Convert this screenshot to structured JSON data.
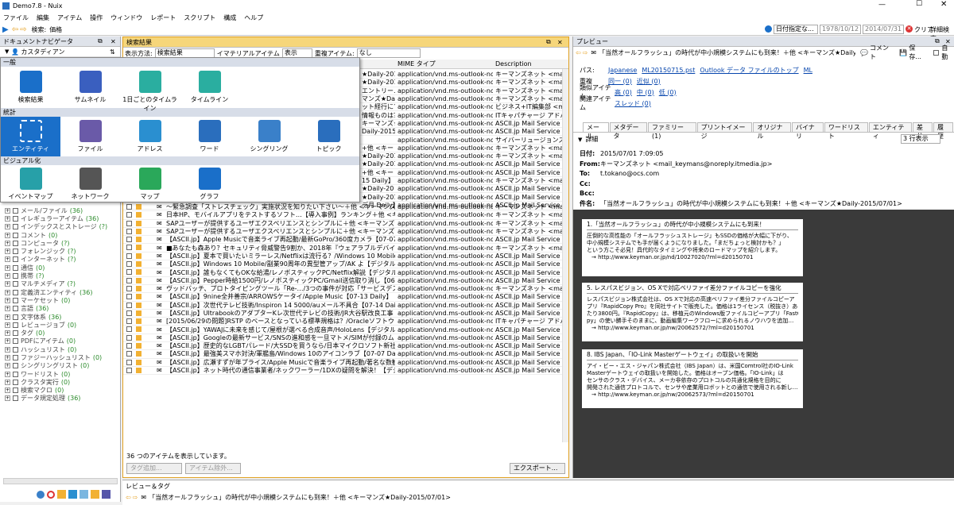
{
  "window": {
    "title": "Demo7.8 - Nuix"
  },
  "menu": [
    "ファイル",
    "編集",
    "アイテム",
    "操作",
    "ウィンドウ",
    "レポート",
    "スクリプト",
    "構成",
    "ヘルプ"
  ],
  "search": {
    "label": "検索:",
    "value": "価格",
    "date_filter": "日付指定な...",
    "date_from": "1978/10/12",
    "date_to": "2014/07/31",
    "clear": "クリア",
    "advanced": "詳細検索"
  },
  "left_panel": {
    "title": "ドキュメントナビゲータ",
    "dropdown": "カスタディアン",
    "tree": [
      {
        "label": "メール/ファイル",
        "count": "(36)"
      },
      {
        "label": "イレギュラーアイテム",
        "count": "(36)"
      },
      {
        "label": "インデックスとストレージ",
        "count": "(?)"
      },
      {
        "label": "コメント",
        "count": "(0)"
      },
      {
        "label": "コンピュータ",
        "count": "(?)"
      },
      {
        "label": "フォレンジック",
        "count": "(?)"
      },
      {
        "label": "インターネット",
        "count": "(?)"
      },
      {
        "label": "通信",
        "count": "(0)"
      },
      {
        "label": "携帯",
        "count": "(?)"
      },
      {
        "label": "マルチメディア",
        "count": "(?)"
      },
      {
        "label": "定義済エンティティ",
        "count": "(36)"
      },
      {
        "label": "マーケセット",
        "count": "(0)"
      },
      {
        "label": "言語",
        "count": "(36)"
      },
      {
        "label": "文字体系",
        "count": "(36)"
      },
      {
        "label": "レビュージョブ",
        "count": "(0)"
      },
      {
        "label": "タグ",
        "count": "(0)"
      },
      {
        "label": "PDFにアイテム",
        "count": "(0)"
      },
      {
        "label": "ハッシュリスト",
        "count": "(0)"
      },
      {
        "label": "ファジーハッシュリスト",
        "count": "(0)"
      },
      {
        "label": "シングリングリスト",
        "count": "(0)"
      },
      {
        "label": "ワードリスト",
        "count": "(0)"
      },
      {
        "label": "クラスタ実行",
        "count": "(0)"
      },
      {
        "label": "検索マクロ",
        "count": "(0)"
      },
      {
        "label": "データ規定処理",
        "count": "(36)"
      }
    ]
  },
  "results": {
    "title": "検索結果",
    "view_label": "表示方法:",
    "view_value": "検索結果",
    "immaterial": "イマテリアルアイテム",
    "immaterial_value": "表示",
    "dup_label": "重複アイテム:",
    "dup_value": "なし",
    "col_mime": "MIME タイプ",
    "col_desc": "Description",
    "mime_rows": [
      "application/vnd.ms-outlook-note",
      "application/vnd.ms-outlook-note",
      "application/vnd.ms-outlook-note",
      "application/vnd.ms-outlook-note",
      "application/vnd.ms-outlook-note",
      "application/vnd.ms-outlook-note",
      "application/vnd.ms-outlook-note",
      "application/vnd.ms-outlook-note",
      "application/vnd.ms-outlook-note",
      "application/vnd.ms-outlook-note",
      "application/vnd.ms-outlook-note",
      "application/vnd.ms-outlook-note",
      "application/vnd.ms-outlook-note",
      "application/vnd.ms-outlook-note",
      "application/vnd.ms-outlook-note",
      "application/vnd.ms-outlook-note",
      "application/vnd.ms-outlook-note"
    ],
    "desc_rows": [
      "キーマンズネット <mail_keyman",
      "キーマンズネット <mail_keyman",
      "キーマンズネット <mail_keyman",
      "キーマンズネット <mail_keyman",
      "ビジネス+IT編集部 <mail@",
      "ITキャパチャージ アドバンス",
      "ASCII.jp Mail Service <noreply",
      "ASCII.jp Mail Service <noreply",
      "サイバーリュージョンズ <mk@",
      "キーマンズネット <mail_keyman",
      "キーマンズネット <mail_keyman",
      "ASCII.jp Mail Service <noreply",
      "ASCII.jp Mail Service <noreply",
      "キーマンズネット <mail_keyman",
      "ASCII.jp Mail Service <noreply",
      "ASCII.jp Mail Service <noreply",
      "ASCII.jp Mail Service <noreply"
    ],
    "upper_partial": [
      "★Daily-201",
      "★Daily-201",
      "エントリー...",
      "マンズ★Da",
      "ット経行にて",
      "情報ものは？",
      "キーマンズ★",
      "Daily-2015/",
      "",
      "+他 <キー",
      "★Daily-201",
      "★Daily-201",
      "+他 <キー",
      "15 Daily】",
      "★Daily-20",
      "★Daily-201",
      "デ月 Daily】"
    ],
    "rows": [
      {
        "s": "～緊急調査「ストレスチェック」実施状況を知りたい下さい～＋他 <キーマンズ★Daily-2015/",
        "m": "application/vnd.ms-outlook-note",
        "d": "キーマンズネット <mail_keyman"
      },
      {
        "s": "日本HP、モバイルアプリをテストするソフト…【導入事例】ランキング＋他 <キーマンズ★Daily-20",
        "m": "application/vnd.ms-outlook-note",
        "d": "キーマンズネット <mail_keyman"
      },
      {
        "s": "SAPユーザーが提供するユーザエクスペリエンスとシンプルに＋他 <キーマンズ★Daily-2015/",
        "m": "application/vnd.ms-outlook-note",
        "d": "キーマンズネット <mail_keyman"
      },
      {
        "s": "SAPユーザーが提供するユーザエクスペリエンスとシンプルに＋他 <キーマンズ★Daily-2015/",
        "m": "application/vnd.ms-outlook-note",
        "d": "キーマンズネット <mail_keyman"
      },
      {
        "s": "【ASCII.jp】Apple Musicで音楽ライブ再起動/最新GoPro/360度カメラ【07-07 Daily】",
        "m": "application/vnd.ms-outlook-note",
        "d": "ASCII.jp Mail Service <noreply"
      },
      {
        "s": "■あなたも森あり？セキュリティ脅威警告9割か、2018年『ウェアラブルデバイス選ビ』のロードマ",
        "m": "application/vnd.ms-outlook-note",
        "d": "キーマンズネット <mail_keyman"
      },
      {
        "s": "【ASCII.jp】夏本で買いたいミラーレス/Netflixは流行る？/Windows 10 Mobile【06-24 Daily】",
        "m": "application/vnd.ms-outlook-note",
        "d": "ASCII.jp Mail Service <noreply"
      },
      {
        "s": "【ASCII.jp】Windows 10 Mobile/副業90周年の異型管アップ/AK よ【デジタル 06-22】",
        "m": "application/vnd.ms-outlook-note",
        "d": "ASCII.jp Mail Service <noreply"
      },
      {
        "s": "【ASCII.jp】誰もなくてもOKな給湯/レノボスティックPC/Netflix解説【デジタル 06-26】",
        "m": "application/vnd.ms-outlook-note",
        "d": "ASCII.jp Mail Service <noreply"
      },
      {
        "s": "【ASCII.jp】Pepper時給1500円/レノボスティックPC/Gmail送信取り消し【06-25 Daily】",
        "m": "application/vnd.ms-outlook-note",
        "d": "ASCII.jp Mail Service <noreply"
      },
      {
        "s": "ヴッドバッチ、プロトタイピングツール「Re-…/3つの事件が対応「サービスデスクツール・・＋他 <キ",
        "m": "application/vnd.ms-outlook-note",
        "d": "キーマンズネット <mail_keyman"
      },
      {
        "s": "【ASCII.jp】9nine全井善宗/ARROWSケータイ/Apple Music【07-13 Daily】",
        "m": "application/vnd.ms-outlook-note",
        "d": "ASCII.jp Mail Service <noreply"
      },
      {
        "s": "【ASCII.jp】次世代テレビ技術/Inspiron 14 5000/auメール不具合【07-14 Daily】",
        "m": "application/vnd.ms-outlook-note",
        "d": "ASCII.jp Mail Service <noreply"
      },
      {
        "s": "【ASCII.jp】UltrabookのアダプターKレ次世代テレビの技術/JR大谷駅改良工事【デジタル 07-15】",
        "m": "application/vnd.ms-outlook-note",
        "d": "ASCII.jp Mail Service <noreply"
      },
      {
        "s": "[2015/06/29の問題]RSTP のベースとなっている標準規格は？/OracleソフトウェアのExadata配置先名",
        "m": "application/vnd.ms-outlook-note",
        "d": "ITキャパチャージ アドバンス"
      },
      {
        "s": "【ASCII.jp】YAWAJに未来を感じて/屋根が選べる合成音声/HoloLens【デジタル 06-30】",
        "m": "application/vnd.ms-outlook-note",
        "d": "ASCII.jp Mail Service <noreply"
      },
      {
        "s": "【ASCII.jp】Googleの最新サービス/SNSの進和感を一旦マトメ/SIMが付録のムック【07-01 Daily】",
        "m": "application/vnd.ms-outlook-note",
        "d": "ASCII.jp Mail Service <noreply"
      },
      {
        "s": "【ASCII.jp】歴史的なLGBTパレード/大SSDを買うなら/日本マイクロソフト新社長【07-03 Daily】",
        "m": "application/vnd.ms-outlook-note",
        "d": "ASCII.jp Mail Service <noreply"
      },
      {
        "s": "【ASCII.jp】最強美スマホ対決/軍艦島/Windows 10のアイコンラブ【07-07 Daily】",
        "m": "application/vnd.ms-outlook-note",
        "d": "ASCII.jp Mail Service <noreply"
      },
      {
        "s": "【ASCII.jp】広瀬すずが年プライス/Apple Musicで音楽ライブ再起動/著名な数観【デジタル 07-09】",
        "m": "application/vnd.ms-outlook-note",
        "d": "ASCII.jp Mail Service <noreply"
      },
      {
        "s": "【ASCII.jp】ネット時代の通信事業者/ネックワーラー/1DXの疑問を解決！【デジタル 07-08】",
        "m": "application/vnd.ms-outlook-note",
        "d": "ASCII.jp Mail Service <noreply"
      }
    ],
    "status": "36 つのアイテムを表示しています。",
    "tag_btn": "タグ追加...",
    "remove_btn": "アイテム除外...",
    "export_btn": "エクスポート..."
  },
  "dropdown_menu": {
    "sec1": "一般",
    "sec1_items": [
      "検索結果",
      "サムネイル",
      "1日ごとのタイムライン",
      "タイムライン"
    ],
    "sec2": "統計",
    "sec2_items": [
      "エンティティ",
      "ファイル",
      "アドレス",
      "ワード",
      "シングリング",
      "トピック"
    ],
    "sec3": "ビジュアル化",
    "sec3_items": [
      "イベントマップ",
      "ネットワーク",
      "マップ",
      "グラフ"
    ]
  },
  "preview": {
    "title": "プレビュー",
    "subject": "「当然オールフラッシュ」の時代が中小規模システムにも到来！＋他 <キーマンズ★Daily-2015/07/01>",
    "comment": "コメント",
    "save": "保存...",
    "auto": "自動",
    "path_label": "パス:",
    "path": [
      "Japanese",
      "ML20150715.pst",
      "Outlook データ ファイルのトップ",
      "ML"
    ],
    "dup_label": "重複",
    "dup_vals": [
      "同一 (0)",
      "近似 (0)"
    ],
    "similar_label": "類似アイテム",
    "similar_vals": [
      "高 (0)",
      "中 (0)",
      "低 (0)"
    ],
    "related_label": "関連アイテム",
    "related_val": "スレッド (0)",
    "tabs": [
      "メール",
      "メタデータ",
      "ファミリー (1)",
      "プリントイメージ",
      "オリジナル",
      "バイナリ",
      "ワードリスト",
      "エンティティ",
      "差分",
      "履歴"
    ],
    "detail": "詳細",
    "lines_sel": "3 行表示",
    "date_label": "日付:",
    "date": "2015/07/01 7:09:05",
    "from_label": "From:",
    "from": "キーマンズネット <mail_keymans@noreply.itmedia.jp>",
    "to_label": "To:",
    "to": "t.tokano@ocs.com",
    "cc_label": "Cc:",
    "bcc_label": "Bcc:",
    "subj_label": "件名:",
    "subj": "「当然オールフラッシュ」の時代が中小規模システムにも到来！＋他 <キーマンズ★Daily-2015/07/01>",
    "cards": [
      {
        "head": "1.「当然オールフラッシュ」の時代が中小規模システムにも到来！",
        "lines": [
          "圧倒的な高性能の「オールフラッシュストレージ」もSSDの価格が大幅に下がり、",
          "中小規模システムでも手が届くようになりました。「まだちょっと検討かも？」",
          "という方こそ必見！具代的なタイミングや将来のロードマップを紹介します。"
        ],
        "url": "→ http://www.keyman.or.jp/nd/10027020/?ml=d20150701"
      },
      {
        "head": "5. レスパスビジョン、OS Xで対応ベリファイ差分ファイルコピーを強化",
        "lines": [
          "レスパスビジョン株式会社は、OS Xで対応の高速ベリファイ差分ファイルコピーア",
          "プリ『RapidCopy Pro』を同社サイトで販売した。価格は1ライセンス（税抜き）あ",
          "たり3800円。『RapidCopy』は、移植元のWindows版ファイルコピーアプリ「FastCo",
          "py」の使い勝手そのままに、動画編集ワークフローに求められるノウハウを追加…"
        ],
        "url": "→ http://www.keyman.or.jp/nw/20062572/?ml=d20150701"
      },
      {
        "head": "8. IBS Japan、「IO-Link Masterゲートウェイ」の取扱いを開始",
        "lines": [
          "アイ・ビー・エス・ジャパン株式会社（IBS Japan）は、米国Comtrol社のIO-Link",
          "Masterゲートウェイの取扱いを開始した。価格はオープン価格。「IO-Link」は",
          "センサのクラス・デバイス、メーカ非依存のプロトコルの共通化規格を目的に",
          "開発された通信プロトコルで、センサや産業用ロボットとの通信で使用される新し…"
        ],
        "url": "→ http://www.keyman.or.jp/nw/20062573/?ml=d20150701"
      }
    ]
  },
  "bottom": {
    "review_title": "レビュー＆タグ",
    "review_subject": "「当然オールフラッシュ」の時代が中小規模システムにも到来！＋他 <キーマンズ★Daily-2015/07/01>"
  }
}
